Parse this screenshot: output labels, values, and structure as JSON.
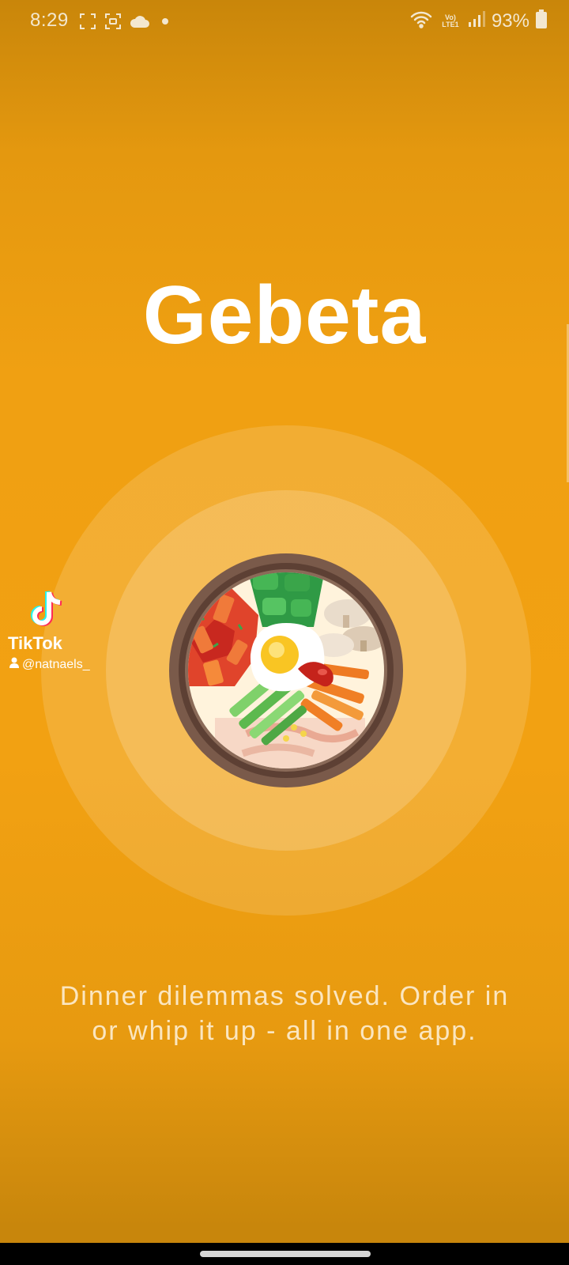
{
  "status_bar": {
    "time": "8:29",
    "battery": "93%",
    "network_label": "Vo) LTE1",
    "icons": [
      "screenshot-icon",
      "screen-record-icon",
      "cloud-icon",
      "dot-icon",
      "wifi-icon",
      "signal-icon",
      "battery-icon"
    ]
  },
  "splash": {
    "title": "Gebeta",
    "tagline_line1": "Dinner dilemmas solved. Order in",
    "tagline_line2": "or whip it up - all in one app.",
    "illustration": "bibimbap-bowl-icon"
  },
  "watermark": {
    "brand": "TikTok",
    "username": "@natnaels_"
  },
  "colors": {
    "background": "#f2a112",
    "title": "#ffffff",
    "tagline": "#fbe6c0",
    "bowl_rim": "#7a5a4a"
  }
}
